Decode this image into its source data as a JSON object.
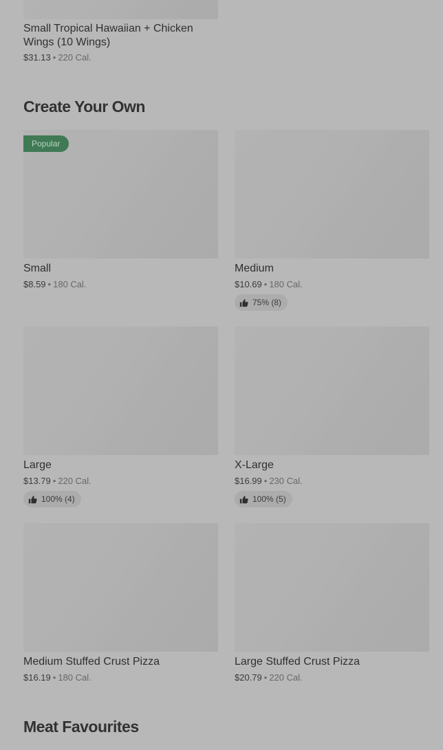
{
  "top_item": {
    "name": "Small Tropical Hawaiian + Chicken Wings (10 Wings)",
    "price": "$31.13",
    "calories": "220 Cal."
  },
  "sections": {
    "create_your_own": "Create Your Own",
    "meat_favourites": "Meat Favourites"
  },
  "separator": "•",
  "badge_popular": "Popular",
  "items": [
    {
      "name": "Small",
      "price": "$8.59",
      "calories": "180 Cal.",
      "rating": ""
    },
    {
      "name": "Medium",
      "price": "$10.69",
      "calories": "180 Cal.",
      "rating": "75% (8)"
    },
    {
      "name": "Large",
      "price": "$13.79",
      "calories": "220 Cal.",
      "rating": "100% (4)"
    },
    {
      "name": "X-Large",
      "price": "$16.99",
      "calories": "230 Cal.",
      "rating": "100% (5)"
    },
    {
      "name": "Medium Stuffed Crust Pizza",
      "price": "$16.19",
      "calories": "180 Cal.",
      "rating": ""
    },
    {
      "name": "Large Stuffed Crust Pizza",
      "price": "$20.79",
      "calories": "220 Cal.",
      "rating": ""
    }
  ],
  "icons": {
    "rating": "thumbs-up-icon"
  }
}
